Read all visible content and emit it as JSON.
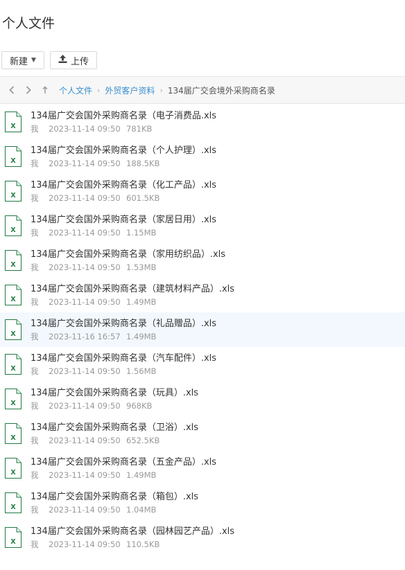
{
  "page": {
    "title": "个人文件"
  },
  "toolbar": {
    "new_label": "新建",
    "upload_label": "上传"
  },
  "breadcrumb": {
    "items": [
      "个人文件",
      "外贸客户资料"
    ],
    "current": "134届广交会境外采购商名录"
  },
  "colors": {
    "accent": "#3a8fd0",
    "excel_green": "#1f7a42",
    "hover_row": "#f3f8fe"
  },
  "files": [
    {
      "name": "134届广交会国外采购商名录（电子消费品.xls",
      "owner": "我",
      "date": "2023-11-14 09:50",
      "size": "781KB"
    },
    {
      "name": "134届广交会国外采购商名录（个人护理）.xls",
      "owner": "我",
      "date": "2023-11-14 09:50",
      "size": "188.5KB"
    },
    {
      "name": "134届广交会国外采购商名录（化工产品）.xls",
      "owner": "我",
      "date": "2023-11-14 09:50",
      "size": "601.5KB"
    },
    {
      "name": "134届广交会国外采购商名录（家居日用）.xls",
      "owner": "我",
      "date": "2023-11-14 09:50",
      "size": "1.15MB"
    },
    {
      "name": "134届广交会国外采购商名录（家用纺织品）.xls",
      "owner": "我",
      "date": "2023-11-14 09:50",
      "size": "1.53MB"
    },
    {
      "name": "134届广交会国外采购商名录（建筑材料产品）.xls",
      "owner": "我",
      "date": "2023-11-14 09:50",
      "size": "1.49MB"
    },
    {
      "name": "134届广交会国外采购商名录（礼品赠品）.xls",
      "owner": "我",
      "date": "2023-11-16 16:57",
      "size": "1.49MB"
    },
    {
      "name": "134届广交会国外采购商名录（汽车配件）.xls",
      "owner": "我",
      "date": "2023-11-14 09:50",
      "size": "1.56MB"
    },
    {
      "name": "134届广交会国外采购商名录（玩具）.xls",
      "owner": "我",
      "date": "2023-11-14 09:50",
      "size": "968KB"
    },
    {
      "name": "134届广交会国外采购商名录（卫浴）.xls",
      "owner": "我",
      "date": "2023-11-14 09:50",
      "size": "652.5KB"
    },
    {
      "name": "134届广交会国外采购商名录（五金产品）.xls",
      "owner": "我",
      "date": "2023-11-14 09:50",
      "size": "1.49MB"
    },
    {
      "name": "134届广交会国外采购商名录（箱包）.xls",
      "owner": "我",
      "date": "2023-11-14 09:50",
      "size": "1.04MB"
    },
    {
      "name": "134届广交会国外采购商名录（园林园艺产品）.xls",
      "owner": "我",
      "date": "2023-11-14 09:50",
      "size": "110.5KB"
    }
  ]
}
